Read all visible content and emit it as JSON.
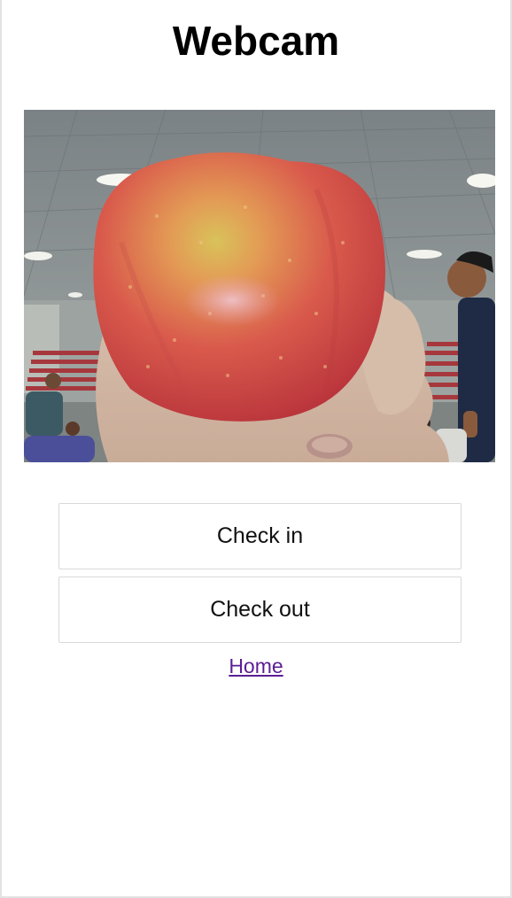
{
  "page": {
    "title": "Webcam"
  },
  "webcam": {
    "subject": "apple held in hand"
  },
  "actions": {
    "check_in_label": "Check in",
    "check_out_label": "Check out"
  },
  "links": {
    "home_label": "Home"
  },
  "colors": {
    "link": "#5b1d94",
    "button_border": "#d9d9d9",
    "page_border": "#e3e3e3"
  }
}
